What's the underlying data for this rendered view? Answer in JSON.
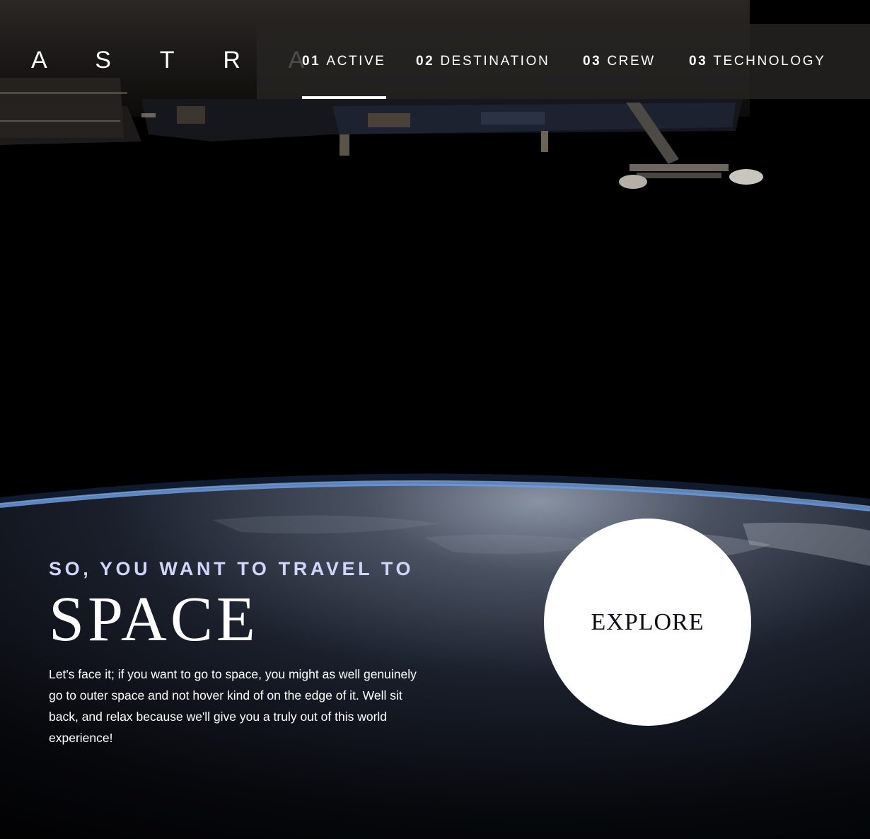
{
  "brand": {
    "logo": "A S T R A"
  },
  "nav": {
    "items": [
      {
        "num": "01",
        "label": "ACTIVE",
        "active": true
      },
      {
        "num": "02",
        "label": "DESTINATION",
        "active": false
      },
      {
        "num": "03",
        "label": "CREW",
        "active": false
      },
      {
        "num": "03",
        "label": "TECHNOLOGY",
        "active": false
      }
    ]
  },
  "hero": {
    "subtitle": "SO, YOU WANT TO TRAVEL TO",
    "title": "SPACE",
    "description": "Let's face it; if you want to go to space, you might as well genuinely go to outer space and not hover kind of on the edge of it. Well sit back, and relax because we'll give you a truly out of this world experience!",
    "explore_label": "EXPLORE"
  },
  "colors": {
    "background": "#000000",
    "subtitle": "#d0d6f9",
    "button_bg": "#ffffff",
    "button_text": "#0b0d17",
    "atmosphere": "#5b8fd8"
  },
  "icons": {
    "background_image": "space-station-earth-illustration"
  }
}
